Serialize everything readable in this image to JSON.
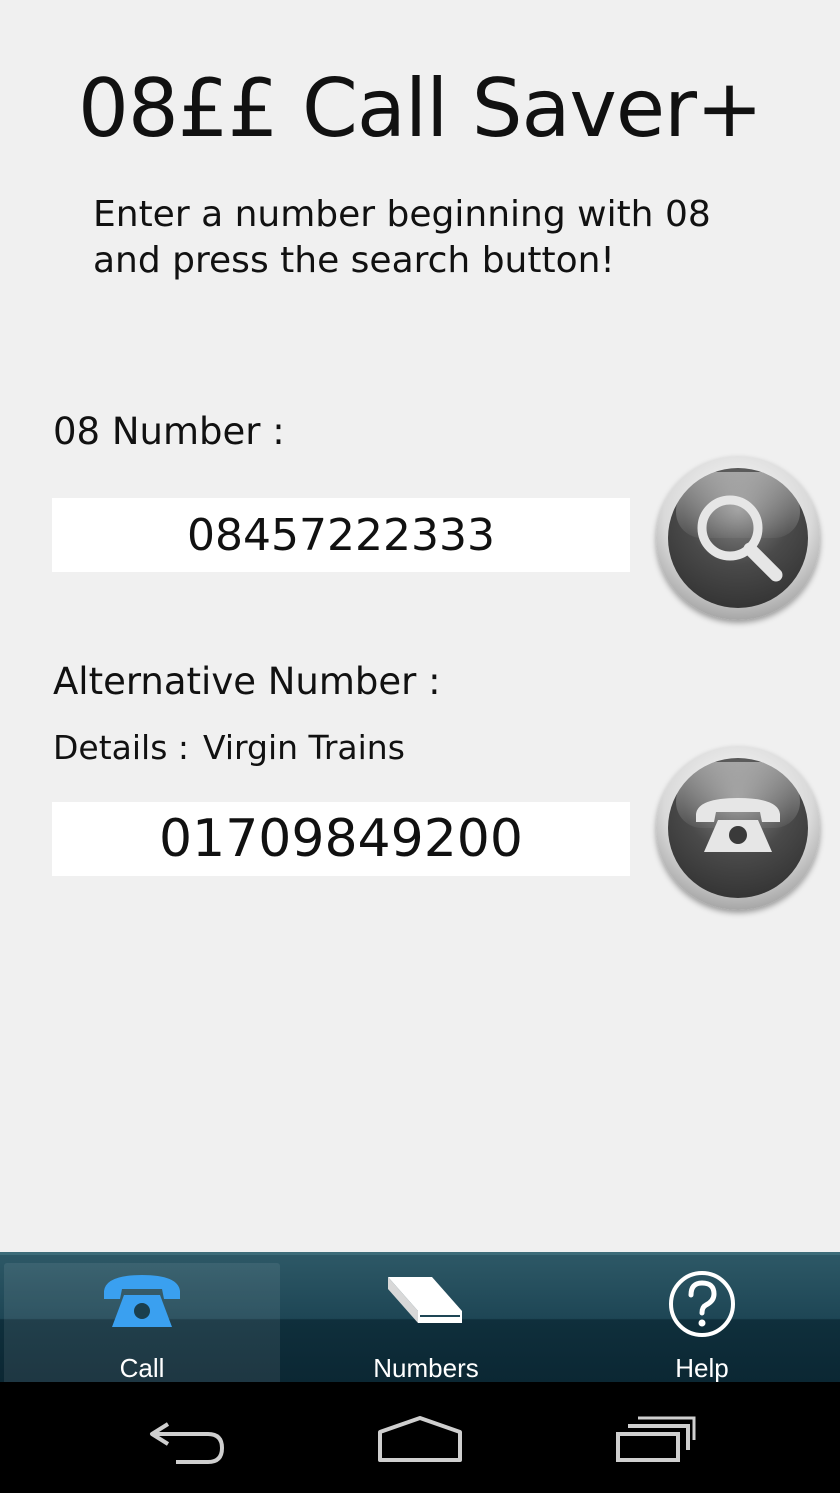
{
  "app": {
    "title": "08££ Call Saver+"
  },
  "instructions": {
    "line1": "Enter a number beginning with 08",
    "line2": "and press the search button!"
  },
  "lookup": {
    "label": "08 Number :",
    "value": "08457222333"
  },
  "alternative": {
    "label": "Alternative Number :",
    "details_label": "Details :",
    "details_value": "Virgin Trains",
    "value": "01709849200"
  },
  "tabs": [
    {
      "label": "Call",
      "icon": "phone-icon",
      "active": true
    },
    {
      "label": "Numbers",
      "icon": "book-icon",
      "active": false
    },
    {
      "label": "Help",
      "icon": "help-icon",
      "active": false
    }
  ],
  "colors": {
    "background": "#f0f0f0",
    "tab_bar": "#1e4655",
    "active_icon": "#3aa0f0"
  }
}
